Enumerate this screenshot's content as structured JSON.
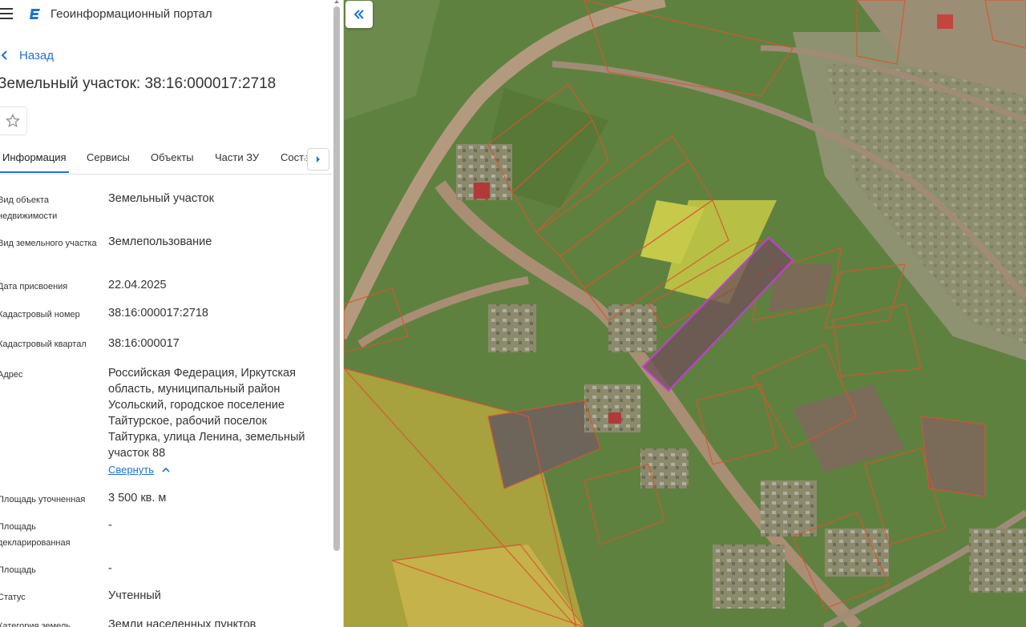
{
  "header": {
    "app_title": "Геоинформационный портал"
  },
  "nav": {
    "back_label": "Назад"
  },
  "object": {
    "title": "Земельный участок: 38:16:000017:2718"
  },
  "tabs": [
    {
      "label": "Информация",
      "active": true
    },
    {
      "label": "Сервисы"
    },
    {
      "label": "Объекты"
    },
    {
      "label": "Части ЗУ"
    },
    {
      "label": "Соста"
    }
  ],
  "info": [
    {
      "label": "Вид объекта недвижимости",
      "value": "Земельный участок"
    },
    {
      "label": "Вид земельного участка",
      "value": "Землепользование"
    },
    {
      "label": "Дата присвоения",
      "value": "22.04.2025"
    },
    {
      "label": "Кадастровый номер",
      "value": "38:16:000017:2718"
    },
    {
      "label": "Кадастровый квартал",
      "value": "38:16:000017"
    },
    {
      "label": "Адрес",
      "value": "Российская Федерация, Иркутская область, муниципальный район Усольский, городское поселение Тайтурское, рабочий поселок Тайтурка, улица Ленина, земельный участок 88"
    },
    {
      "label": "Площадь уточненная",
      "value": "3 500 кв. м"
    },
    {
      "label": "Площадь декларированная",
      "value": "-"
    },
    {
      "label": "Площадь",
      "value": "-"
    },
    {
      "label": "Статус",
      "value": "Учтенный"
    },
    {
      "label": "Категория земель",
      "value": "Земли населенных пунктов"
    }
  ],
  "address_toggle": "Свернуть",
  "colors": {
    "accent": "#1f72d6",
    "selected_parcel": "#c23dd8",
    "parcel_border": "#d9542f"
  },
  "icons": [
    "menu-icon",
    "portal-logo-icon",
    "chevron-left-icon",
    "star-icon",
    "chevron-right-icon",
    "chevron-up-icon",
    "double-chevron-left-icon"
  ]
}
